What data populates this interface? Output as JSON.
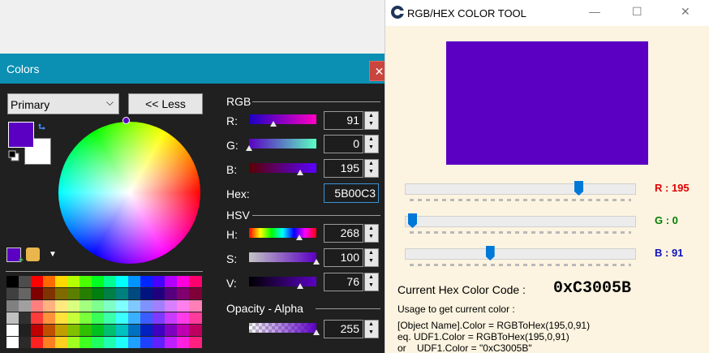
{
  "background_window_color": "#f0f0f0",
  "colors_dialog": {
    "title": "Colors",
    "close_symbol": "✕",
    "color_slot_dropdown": {
      "value": "Primary",
      "chevron": "⌵"
    },
    "less_button_label": "<< Less",
    "primary_color": "#5b00c3",
    "secondary_color": "#ffffff",
    "wheel": {
      "handle_hue_deg": 268,
      "handle_saturation_pct": 100
    },
    "palette_grid": [
      [
        "#000000",
        "#4d4d4d",
        "#ff0000",
        "#ff6a00",
        "#ffd800",
        "#b6ff00",
        "#4cff00",
        "#00ff21",
        "#00ff90",
        "#00ffff",
        "#0094ff",
        "#0026ff",
        "#4800ff",
        "#b200ff",
        "#ff00dc",
        "#ff006e"
      ],
      [
        "#404040",
        "#656565",
        "#7f0000",
        "#7f3300",
        "#7f6a00",
        "#5b7f00",
        "#267f00",
        "#007f0e",
        "#007f46",
        "#007f7f",
        "#004a7f",
        "#00137f",
        "#21007f",
        "#57007f",
        "#7f006e",
        "#7f0037"
      ],
      [
        "#808080",
        "#a0a0a0",
        "#ff7f7f",
        "#ffb27f",
        "#ffe97f",
        "#daff7f",
        "#a5ff7f",
        "#7fff8e",
        "#7fffc5",
        "#7fffff",
        "#7fc9ff",
        "#7f92ff",
        "#a17fff",
        "#d67fff",
        "#ff7fed",
        "#ff7fb6"
      ],
      [
        "#c0c0c0",
        "#303030",
        "#ff3b3b",
        "#ff923b",
        "#ffe23b",
        "#c8ff3b",
        "#7bff3b",
        "#3bff58",
        "#3bffab",
        "#3bffff",
        "#3bb0ff",
        "#3b5cff",
        "#7e3bff",
        "#c83bff",
        "#ff3bea",
        "#ff3b9b"
      ],
      [
        "#ffffff",
        "#202020",
        "#c00000",
        "#c05000",
        "#c0a000",
        "#80c000",
        "#30c000",
        "#00c020",
        "#00c070",
        "#00c0c0",
        "#0070c0",
        "#0020c0",
        "#4000c0",
        "#8000c0",
        "#c000b0",
        "#c00060"
      ],
      [
        "#ffffff",
        "#2a2a2a",
        "#ff2020",
        "#ff8020",
        "#ffd020",
        "#a0ff20",
        "#40ff20",
        "#20ff60",
        "#20ffb0",
        "#20ffff",
        "#20a0ff",
        "#2040ff",
        "#6020ff",
        "#c020ff",
        "#ff20e0",
        "#ff2080"
      ]
    ],
    "rgb_section": "RGB",
    "hsv_section": "HSV",
    "opacity_section": "Opacity - Alpha",
    "channels": [
      {
        "label": "R:",
        "value": "91",
        "level": 0.357,
        "from": "#1a00c3",
        "to": "#ff00c3"
      },
      {
        "label": "G:",
        "value": "0",
        "level": 0.0,
        "from": "#5b00c3",
        "to": "#5bffc3"
      },
      {
        "label": "B:",
        "value": "195",
        "level": 0.765,
        "from": "#5b0000",
        "to": "#5b00ff"
      }
    ],
    "hex_label": "Hex:",
    "hex_value": "5B00C3",
    "hsv": [
      {
        "label": "H:",
        "value": "268",
        "level": 0.744
      },
      {
        "label": "S:",
        "value": "100",
        "level": 1.0
      },
      {
        "label": "V:",
        "value": "76",
        "level": 0.76
      }
    ],
    "alpha_value": "255",
    "alpha_level": 1.0,
    "spin_up": "▲",
    "spin_down": "▼",
    "palette_dropdown_arrow": "▼",
    "add_swatch_plus": "+"
  },
  "tool_window": {
    "title": "RGB/HEX COLOR TOOL",
    "minimize_symbol": "—",
    "maximize_symbol": "☐",
    "close_symbol": "✕",
    "preview_color": "#5b00c3",
    "sliders": [
      {
        "label": "R : 195",
        "level": 0.765,
        "label_color": "#e00000"
      },
      {
        "label": "G : 0",
        "level": 0.0,
        "label_color": "#008000"
      },
      {
        "label": "B : 91",
        "level": 0.357,
        "label_color": "#1010c0"
      }
    ],
    "current_hex_label": "Current Hex Color Code :",
    "current_hex_value": "0xC3005B",
    "usage_title": "Usage to get current color :",
    "usage_lines": [
      "[Object Name].Color = RGBToHex(195,0,91)",
      "eq. UDF1.Color = RGBToHex(195,0,91)",
      "or    UDF1.Color = \"0xC3005B\""
    ]
  }
}
